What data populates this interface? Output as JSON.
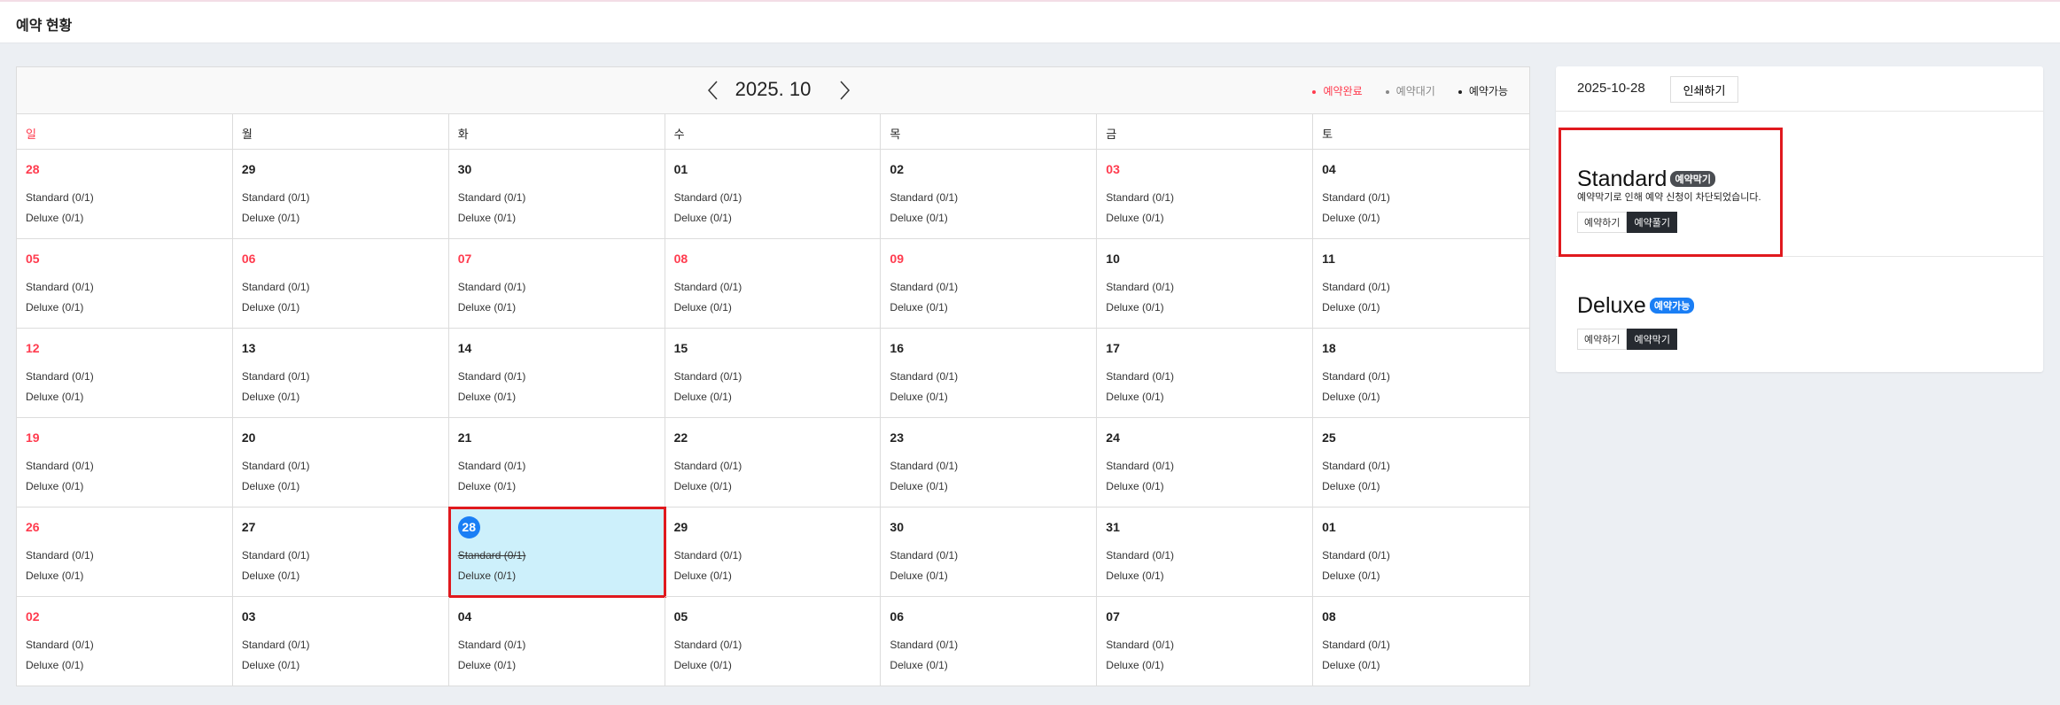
{
  "header": {
    "title": "예약 현황"
  },
  "calendar": {
    "month_label": "2025. 10",
    "legend": [
      {
        "label": "예약완료",
        "color": "#ff3b4e"
      },
      {
        "label": "예약대기",
        "color": "#888888"
      },
      {
        "label": "예약가능",
        "color": "#222222"
      }
    ],
    "weekdays": [
      "일",
      "월",
      "화",
      "수",
      "목",
      "금",
      "토"
    ],
    "weeks": [
      [
        {
          "d": "28",
          "red": true
        },
        {
          "d": "29"
        },
        {
          "d": "30"
        },
        {
          "d": "01"
        },
        {
          "d": "02"
        },
        {
          "d": "03",
          "red": true
        },
        {
          "d": "04"
        }
      ],
      [
        {
          "d": "05",
          "red": true
        },
        {
          "d": "06",
          "red": true
        },
        {
          "d": "07",
          "red": true
        },
        {
          "d": "08",
          "red": true
        },
        {
          "d": "09",
          "red": true
        },
        {
          "d": "10"
        },
        {
          "d": "11"
        }
      ],
      [
        {
          "d": "12",
          "red": true
        },
        {
          "d": "13"
        },
        {
          "d": "14"
        },
        {
          "d": "15"
        },
        {
          "d": "16"
        },
        {
          "d": "17"
        },
        {
          "d": "18"
        }
      ],
      [
        {
          "d": "19",
          "red": true
        },
        {
          "d": "20"
        },
        {
          "d": "21"
        },
        {
          "d": "22"
        },
        {
          "d": "23"
        },
        {
          "d": "24"
        },
        {
          "d": "25"
        }
      ],
      [
        {
          "d": "26",
          "red": true
        },
        {
          "d": "27"
        },
        {
          "d": "28",
          "selected": true,
          "standard_blocked": true
        },
        {
          "d": "29"
        },
        {
          "d": "30"
        },
        {
          "d": "31"
        },
        {
          "d": "01"
        }
      ],
      [
        {
          "d": "02",
          "red": true
        },
        {
          "d": "03"
        },
        {
          "d": "04"
        },
        {
          "d": "05"
        },
        {
          "d": "06"
        },
        {
          "d": "07"
        },
        {
          "d": "08"
        }
      ]
    ],
    "standard_label": "Standard (0/1)",
    "deluxe_label": "Deluxe (0/1)"
  },
  "side": {
    "date": "2025-10-28",
    "print_label": "인쇄하기",
    "standard": {
      "title": "Standard",
      "badge": "예약막기",
      "badge_color": "#4a4d52",
      "desc": "예약막기로 인해 예약 신청이 차단되었습니다.",
      "btn1": "예약하기",
      "btn2": "예약풀기"
    },
    "deluxe": {
      "title": "Deluxe",
      "badge": "예약가능",
      "badge_color": "#1a7ef5",
      "btn1": "예약하기",
      "btn2": "예약막기"
    }
  }
}
